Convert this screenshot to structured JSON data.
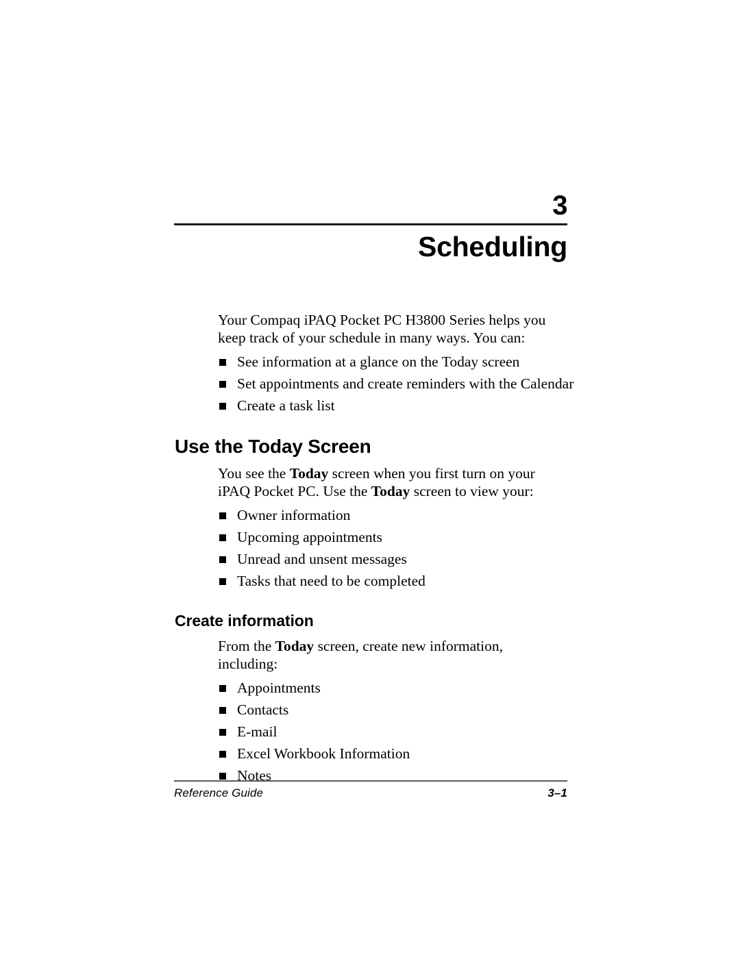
{
  "chapter": {
    "number": "3",
    "title": "Scheduling"
  },
  "intro": {
    "paragraph_prefix": "Your Compaq iPAQ Pocket PC H3800 Series helps you keep track of your schedule in many ways. You can:",
    "bullets": [
      "See information at a glance on the Today screen",
      "Set appointments and create reminders with the Calendar",
      "Create a task list"
    ]
  },
  "section_today": {
    "heading": "Use the Today Screen",
    "paragraph": {
      "part1": "You see the ",
      "bold1": "Today",
      "part2": " screen when you first turn on your iPAQ Pocket PC. Use the ",
      "bold2": "Today",
      "part3": " screen to view your:"
    },
    "bullets": [
      "Owner information",
      "Upcoming appointments",
      "Unread and unsent messages",
      "Tasks that need to be completed"
    ]
  },
  "section_create": {
    "heading": "Create information",
    "paragraph": {
      "part1": "From the ",
      "bold1": "Today",
      "part2": " screen, create new information, including:"
    },
    "bullets": [
      "Appointments",
      "Contacts",
      "E-mail",
      "Excel Workbook Information",
      "Notes"
    ]
  },
  "footer": {
    "left": "Reference Guide",
    "right": "3–1"
  }
}
